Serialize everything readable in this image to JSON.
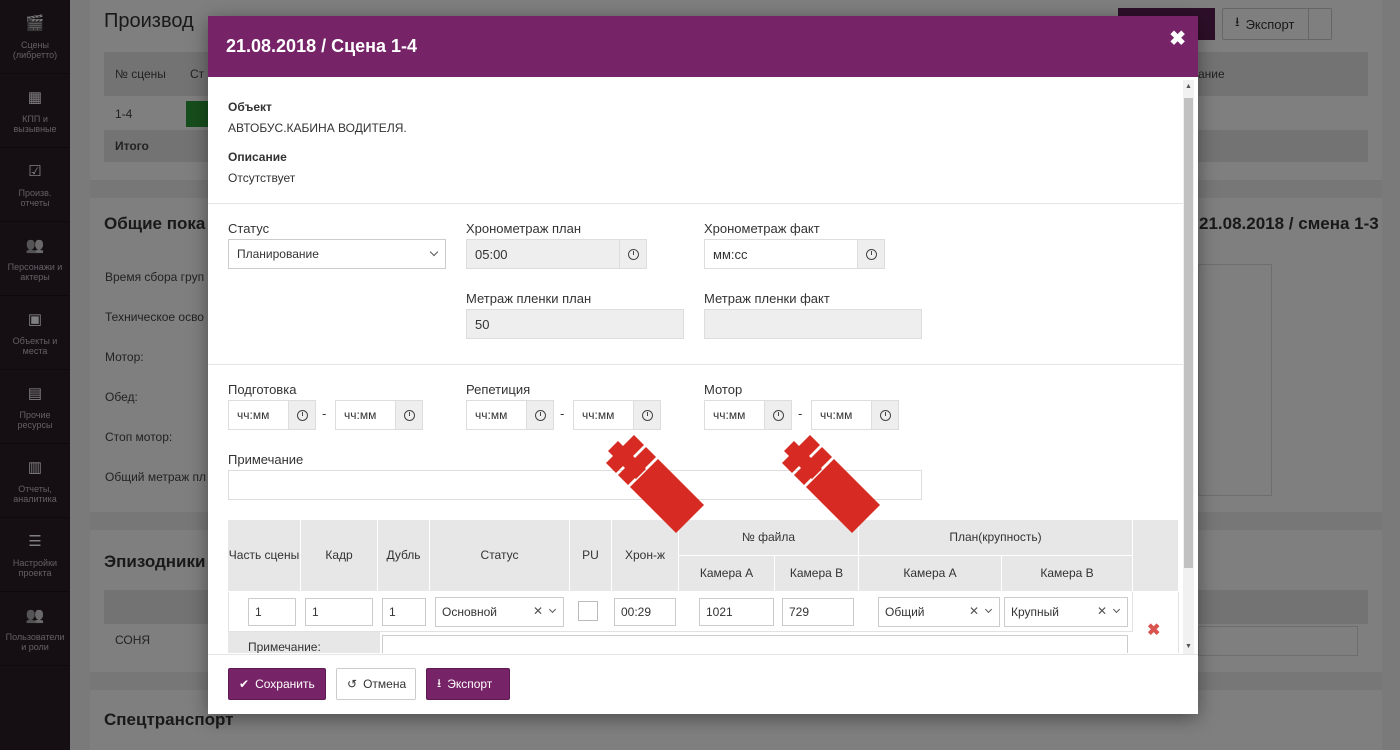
{
  "sidebar": {
    "items": [
      {
        "label": "Сцены (либретто)",
        "icon": "clapper-icon"
      },
      {
        "label": "КПП и вызывные",
        "icon": "calendar-icon"
      },
      {
        "label": "Произв. отчеты",
        "icon": "check-icon"
      },
      {
        "label": "Персонажи и актеры",
        "icon": "users-icon"
      },
      {
        "label": "Объекты и места",
        "icon": "image-icon"
      },
      {
        "label": "Прочие ресурсы",
        "icon": "archive-icon"
      },
      {
        "label": "Отчеты, аналитика",
        "icon": "chart-icon"
      },
      {
        "label": "Настройки проекта",
        "icon": "sliders-icon"
      },
      {
        "label": "Пользователи и роли",
        "icon": "users-icon"
      }
    ]
  },
  "background": {
    "page_title": "Производ",
    "export_label": "Экспорт",
    "col_scene_no": "№ сцены",
    "col_status_short": "Ст",
    "col_remark_tail": "ание",
    "row_scene": "1-4",
    "total_label": "Итого",
    "section_general": "Общие пока",
    "right_heading": "21.08.2018 / смена 1-3",
    "rows": [
      "Время сбора груп",
      "Техническое осво",
      "Мотор:",
      "Обед:",
      "Стоп мотор:",
      "Общий метраж пл"
    ],
    "section_episodic": "Эпизодники",
    "episodic_row": "СОНЯ",
    "section_transport": "Спецтранспорт"
  },
  "modal": {
    "title": "21.08.2018 / Сцена 1-4",
    "object_label": "Объект",
    "object_value": "АВТОБУС.КАБИНА ВОДИТЕЛЯ.",
    "description_label": "Описание",
    "description_value": "Отсутствует",
    "status_label": "Статус",
    "status_value": "Планирование",
    "timing_plan_label": "Хронометраж план",
    "timing_plan_value": "05:00",
    "timing_fact_label": "Хронометраж факт",
    "timing_fact_placeholder": "мм:сс",
    "film_plan_label": "Метраж пленки план",
    "film_plan_value": "50",
    "film_fact_label": "Метраж пленки факт",
    "film_fact_value": "",
    "prep_label": "Подготовка",
    "rehearsal_label": "Репетиция",
    "motor_label": "Мотор",
    "time_placeholder": "чч:мм",
    "note_label": "Примечание",
    "note_value": "",
    "table": {
      "headers": {
        "part": "Часть сцены",
        "frame": "Кадр",
        "take": "Дубль",
        "status": "Статус",
        "pu": "PU",
        "chron": "Хрон-ж",
        "file_no": "№ файла",
        "plan_size": "План(крупность)",
        "cam_a": "Камера А",
        "cam_b": "Камера В"
      },
      "row": {
        "part": "1",
        "frame": "1",
        "take": "1",
        "status": "Основной",
        "chron": "00:29",
        "file_a": "1021",
        "file_b": "729",
        "plan_a": "Общий",
        "plan_b": "Крупный"
      },
      "row_note_label": "Примечание:"
    },
    "save_label": "Сохранить",
    "cancel_label": "Отмена",
    "export_label": "Экспорт"
  },
  "colors": {
    "accent": "#762467",
    "sidebar": "#2b1c27",
    "arrow": "#d62a22"
  }
}
